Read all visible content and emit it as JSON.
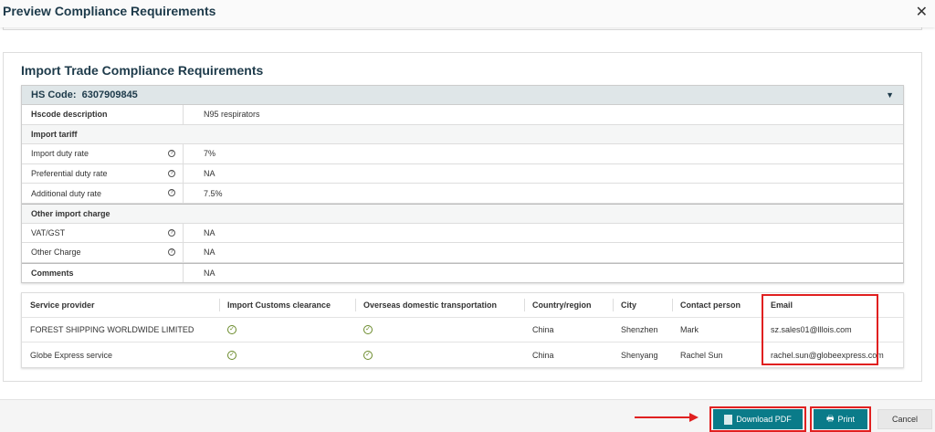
{
  "dialog": {
    "title": "Preview Compliance Requirements",
    "close": "✕"
  },
  "section": {
    "title": "Import Trade Compliance Requirements"
  },
  "hs": {
    "label": "HS Code:",
    "code": "6307909845",
    "desc_label": "Hscode description",
    "desc_value": "N95 respirators",
    "import_tariff": "Import tariff",
    "tariff_rows": [
      {
        "label": "Import duty rate",
        "value": "7%"
      },
      {
        "label": "Preferential duty rate",
        "value": "NA"
      },
      {
        "label": "Additional duty rate",
        "value": "7.5%"
      }
    ],
    "other_charge": "Other import charge",
    "charge_rows": [
      {
        "label": "VAT/GST",
        "value": "NA"
      },
      {
        "label": "Other Charge",
        "value": "NA"
      }
    ],
    "comments_label": "Comments",
    "comments_value": "NA"
  },
  "providers": {
    "headers": [
      "Service provider",
      "Import Customs clearance",
      "Overseas domestic transportation",
      "Country/region",
      "City",
      "Contact person",
      "Email"
    ],
    "rows": [
      {
        "name": "FOREST SHIPPING WORLDWIDE LIMITED",
        "customs": true,
        "transport": true,
        "country": "China",
        "city": "Shenzhen",
        "contact": "Mark",
        "email": "sz.sales01@lllois.com"
      },
      {
        "name": "Globe Express service",
        "customs": true,
        "transport": true,
        "country": "China",
        "city": "Shenyang",
        "contact": "Rachel Sun",
        "email": "rachel.sun@globeexpress.com"
      }
    ]
  },
  "footer": {
    "download": "Download PDF",
    "print": "Print",
    "cancel": "Cancel"
  },
  "colors": {
    "primary": "#0a7b89",
    "highlight": "#e02020",
    "check": "#6a8a2a"
  }
}
